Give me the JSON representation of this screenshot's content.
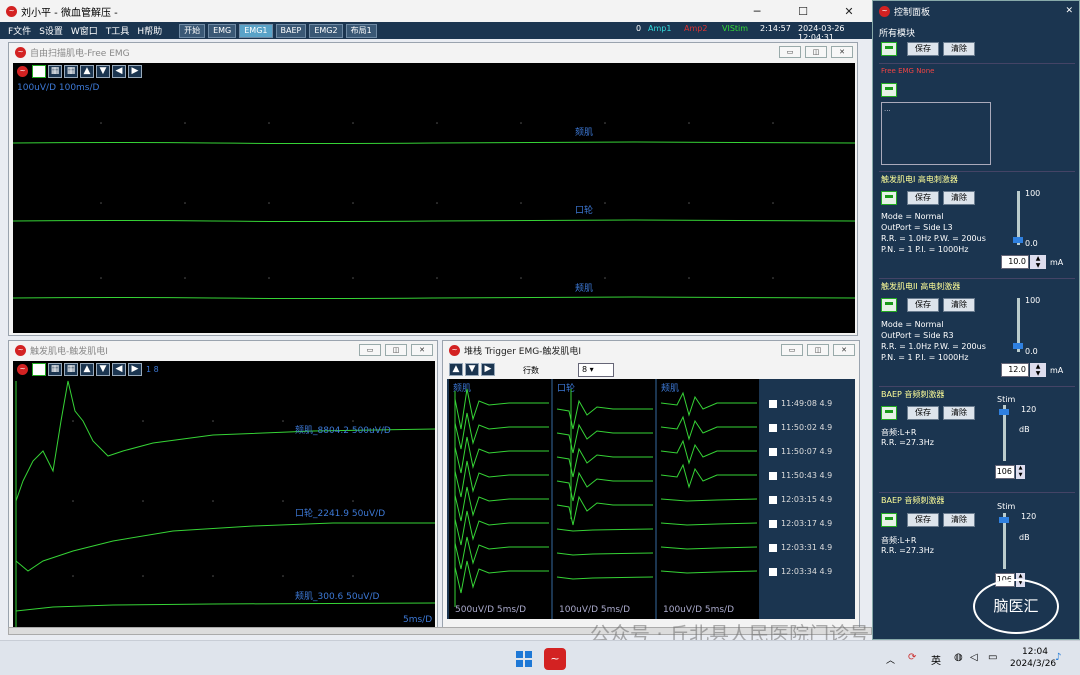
{
  "main_window": {
    "title": "刘小平 - 微血管解压 -"
  },
  "menu": {
    "items": [
      "F文件",
      "S设置",
      "W窗口",
      "T工具",
      "H帮助"
    ],
    "buttons": [
      "开始",
      "EMG",
      "EMG1",
      "BAEP",
      "EMG2",
      "布局1"
    ]
  },
  "status": {
    "count": "0",
    "amp1": "Amp1",
    "amp2": "Amp2",
    "vistim": "VIStim",
    "elapsed": "2:14:57",
    "datetime": "2024-03-26 12:04:31"
  },
  "free_emg": {
    "title": "自由扫描肌电-Free EMG",
    "scale": "100uV/D  100ms/D",
    "channels": [
      "颏肌",
      "口轮",
      "颊肌"
    ]
  },
  "trigger_emg": {
    "title": "触发肌电-触发肌电I",
    "pages": "1  8",
    "channels": [
      "颏肌_8804.2  500uV/D",
      "口轮_2241.9  50uV/D",
      "颊肌_300.6  50uV/D"
    ],
    "footer": "5ms/D"
  },
  "stacked_emg": {
    "title": "堆栈 Trigger EMG-触发肌电I",
    "rows_label": "行数",
    "rows_value": "8",
    "columns": [
      "颏肌",
      "口轮",
      "颊肌"
    ],
    "scales": [
      "500uV/D 5ms/D",
      "100uV/D 5ms/D",
      "100uV/D 5ms/D"
    ],
    "entries": [
      {
        "time": "11:49:08",
        "value": "4.9"
      },
      {
        "time": "11:50:02",
        "value": "4.9"
      },
      {
        "time": "11:50:07",
        "value": "4.9"
      },
      {
        "time": "11:50:43",
        "value": "4.9"
      },
      {
        "time": "12:03:15",
        "value": "4.9"
      },
      {
        "time": "12:03:17",
        "value": "4.9"
      },
      {
        "time": "12:03:31",
        "value": "4.9"
      },
      {
        "time": "12:03:34",
        "value": "4.9"
      }
    ]
  },
  "control_panel": {
    "title": "控制面板",
    "all_modules": "所有模块",
    "save": "保存",
    "clear": "清除",
    "free_emg": {
      "label": "Free EMG  None",
      "box": "..."
    },
    "stim1": {
      "label": "触发肌电I  高电刺激器",
      "mode": "Mode = Normal",
      "outport": "OutPort = Side L3",
      "rr": "R.R. = 1.0Hz  P.W. = 200us",
      "pn": "P.N. = 1  P.I. = 1000Hz",
      "max": "100",
      "min": "0.0",
      "value": "10.0",
      "unit": "mA"
    },
    "stim2": {
      "label": "触发肌电II  高电刺激器",
      "mode": "Mode = Normal",
      "outport": "OutPort = Side R3",
      "rr": "R.R. = 1.0Hz  P.W. = 200us",
      "pn": "P.N. = 1  P.I. = 1000Hz",
      "max": "100",
      "min": "0.0",
      "value": "12.0",
      "unit": "mA"
    },
    "baep1": {
      "label": "BAEP  音频刺激器",
      "stim": "Stim",
      "sound": "音频:L+R",
      "rr": "R.R. =27.3Hz",
      "max": "120",
      "unit": "dB",
      "value": "106"
    },
    "baep2": {
      "label": "BAEP  音频刺激器",
      "stim": "Stim",
      "sound": "音频:L+R",
      "rr": "R.R. =27.3Hz",
      "max": "120",
      "unit": "dB",
      "value": "106"
    }
  },
  "taskbar": {
    "time": "12:04",
    "date": "2024/3/26",
    "ime": "英"
  },
  "watermark": {
    "text": "公众号 · 丘北县人民医院门诊号",
    "logo": "脑医汇"
  },
  "colors": {
    "trace": "#36d336",
    "label": "#3d79d6",
    "panel": "#1b3550"
  }
}
